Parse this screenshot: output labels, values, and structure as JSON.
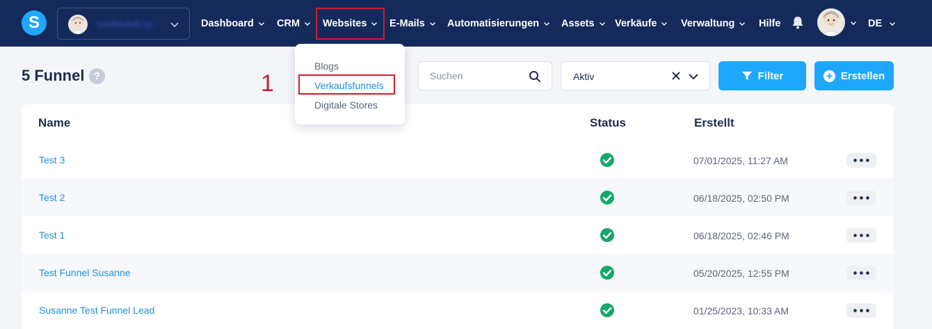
{
  "brand": {
    "logo_letter": "S",
    "color": "#1ea7fd",
    "nav_bg": "#142a5b"
  },
  "account": {
    "name": "swdlinde6.sy...",
    "chevron_icon": "chevron-down-icon"
  },
  "nav": {
    "items": [
      {
        "label": "Dashboard",
        "has_dropdown": true
      },
      {
        "label": "CRM",
        "has_dropdown": true
      },
      {
        "label": "Websites",
        "has_dropdown": true,
        "highlighted": true
      },
      {
        "label": "E-Mails",
        "has_dropdown": true
      },
      {
        "label": "Automatisierungen",
        "has_dropdown": true
      },
      {
        "label": "Assets",
        "has_dropdown": true
      },
      {
        "label": "Verkäufe",
        "has_dropdown": true
      },
      {
        "label": "Verwaltung",
        "has_dropdown": true
      },
      {
        "label": "Hilfe",
        "has_dropdown": false
      }
    ],
    "bell_icon": "bell-icon",
    "language": "DE"
  },
  "dropdown": {
    "items": [
      {
        "label": "Blogs",
        "active": false
      },
      {
        "label": "Verkaufsfunnels",
        "active": true,
        "highlighted": true
      },
      {
        "label": "Digitale Stores",
        "active": false
      }
    ]
  },
  "annotation": {
    "step_number": "1",
    "color": "#c8202a"
  },
  "page": {
    "title": "5 Funnel",
    "help_icon": "?"
  },
  "toolbar": {
    "search_placeholder": "Suchen",
    "status_value": "Aktiv",
    "filter_label": "Filter",
    "create_label": "Erstellen"
  },
  "table": {
    "columns": {
      "name": "Name",
      "status": "Status",
      "created": "Erstellt"
    },
    "rows": [
      {
        "name": "Test 3",
        "status": "active",
        "created": "07/01/2025, 11:27 AM"
      },
      {
        "name": "Test 2",
        "status": "active",
        "created": "06/18/2025, 02:50 PM"
      },
      {
        "name": "Test 1",
        "status": "active",
        "created": "06/18/2025, 02:46 PM"
      },
      {
        "name": "Test Funnel Susanne",
        "status": "active",
        "created": "05/20/2025, 12:55 PM"
      },
      {
        "name": "Susanne Test Funnel Lead",
        "status": "active",
        "created": "01/25/2023, 10:33 AM"
      }
    ],
    "status_color": "#15a86b"
  }
}
